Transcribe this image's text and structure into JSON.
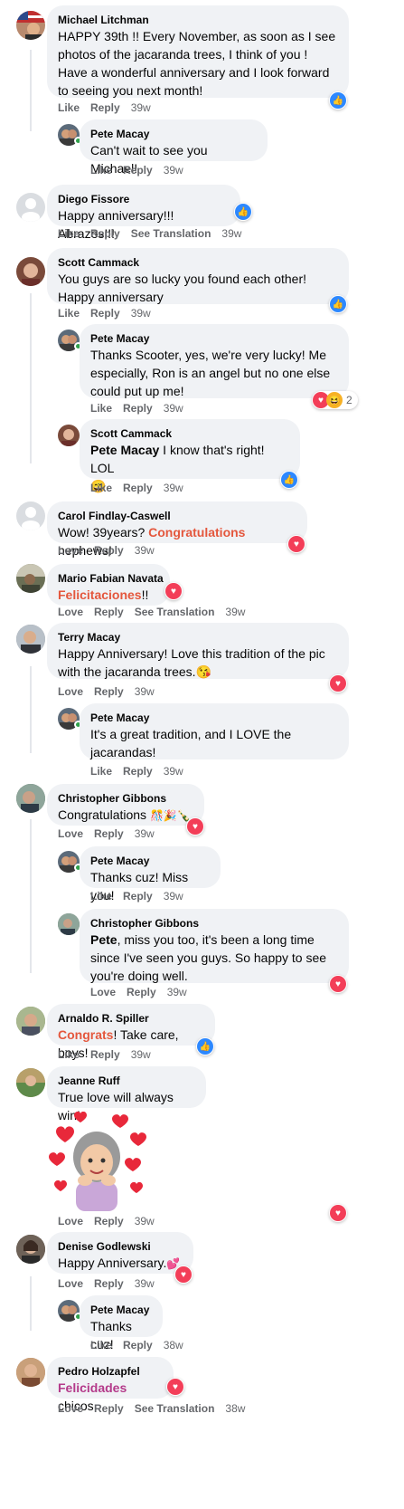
{
  "actions": {
    "like": "Like",
    "love": "Love",
    "reply": "Reply",
    "see_translation": "See Translation"
  },
  "reaction_count_pete2": "2",
  "comments": [
    {
      "name": "Michael Litchman",
      "text": "HAPPY 39th !! Every November, as soon as I see photos of the jacaranda trees, I think of you ! Have a wonderful anniversary and I look forward to seeing you next month!",
      "time": "39w"
    },
    {
      "name": "Pete Macay",
      "text": "Can't wait to see you Michael!",
      "time": "39w"
    },
    {
      "name": "Diego Fissore",
      "text": "Happy anniversary!!! Abrazos!!!",
      "time": "39w"
    },
    {
      "name": "Scott Cammack",
      "text": "You guys are so lucky you found each other! Happy anniversary",
      "time": "39w"
    },
    {
      "name": "Pete Macay",
      "text": "Thanks Scooter, yes, we're very lucky! Me especially, Ron is an angel but no one else could put up me!",
      "time": "39w"
    },
    {
      "name": "Scott Cammack",
      "tag": "Pete Macay",
      "text": " I know that's right! LOL",
      "emoji": "😄",
      "time": "39w"
    },
    {
      "name": "Carol Findlay-Caswell",
      "text_a": "Wow! 39years? ",
      "highlight": "Congratulations",
      "text_b": " nephews!",
      "time": "39w"
    },
    {
      "name": "Mario Fabian Navata",
      "highlight": "Felicitaciones",
      "text_b": "!!",
      "time": "39w"
    },
    {
      "name": "Terry Macay",
      "text": "Happy Anniversary! Love this tradition of the pic with the jacaranda trees.",
      "emoji": "😘",
      "time": "39w"
    },
    {
      "name": "Pete Macay",
      "text": "It's a great tradition, and I LOVE the jacarandas!",
      "time": "39w"
    },
    {
      "name": "Christopher Gibbons",
      "text": "Congratulations ",
      "emoji": "🎊🎉🍾",
      "time": "39w"
    },
    {
      "name": "Pete Macay",
      "text": "Thanks cuz! Miss you!",
      "time": "39w"
    },
    {
      "name": "Christopher Gibbons",
      "tag": "Pete",
      "text": ", miss you too, it's been a long time since I've seen you guys. So happy to see you're doing well.",
      "time": "39w"
    },
    {
      "name": "Arnaldo R. Spiller",
      "highlight": "Congrats",
      "text_b": "! Take care, boys!",
      "time": "39w"
    },
    {
      "name": "Jeanne Ruff",
      "text": "True love will always win!",
      "time": "39w"
    },
    {
      "name": "Denise Godlewski",
      "text": "Happy Anniversary.",
      "emoji": "💕",
      "time": "39w"
    },
    {
      "name": "Pete Macay",
      "text": "Thanks cuz!",
      "time": "38w"
    },
    {
      "name": "Pedro Holzapfel",
      "highlight": "Felicidades",
      "text_b": " chicos",
      "time": "38w"
    }
  ]
}
